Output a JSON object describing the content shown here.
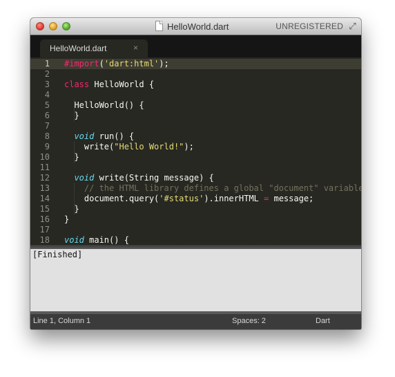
{
  "window": {
    "title": "HelloWorld.dart",
    "license_notice": "UNREGISTERED"
  },
  "tabs": [
    {
      "label": "HelloWorld.dart",
      "close_glyph": "×",
      "active": true
    }
  ],
  "editor": {
    "lines": [
      {
        "n": "1",
        "tokens": [
          {
            "t": "#import",
            "c": "kw"
          },
          {
            "t": "(",
            "c": ""
          },
          {
            "t": "'dart:html'",
            "c": "st"
          },
          {
            "t": ");",
            "c": ""
          }
        ]
      },
      {
        "n": "2",
        "tokens": []
      },
      {
        "n": "3",
        "tokens": [
          {
            "t": "class",
            "c": "kw"
          },
          {
            "t": " HelloWorld {",
            "c": ""
          }
        ]
      },
      {
        "n": "4",
        "tokens": []
      },
      {
        "n": "5",
        "tokens": [
          {
            "t": "  HelloWorld() {",
            "c": ""
          }
        ]
      },
      {
        "n": "6",
        "tokens": [
          {
            "t": "  }",
            "c": ""
          }
        ]
      },
      {
        "n": "7",
        "tokens": []
      },
      {
        "n": "8",
        "tokens": [
          {
            "t": "  ",
            "c": ""
          },
          {
            "t": "void",
            "c": "ty"
          },
          {
            "t": " run() {",
            "c": ""
          }
        ]
      },
      {
        "n": "9",
        "tokens": [
          {
            "t": "    write(",
            "c": ""
          },
          {
            "t": "\"Hello World!\"",
            "c": "st"
          },
          {
            "t": ");",
            "c": ""
          }
        ]
      },
      {
        "n": "10",
        "tokens": [
          {
            "t": "  }",
            "c": ""
          }
        ]
      },
      {
        "n": "11",
        "tokens": []
      },
      {
        "n": "12",
        "tokens": [
          {
            "t": "  ",
            "c": ""
          },
          {
            "t": "void",
            "c": "ty"
          },
          {
            "t": " write(String message) {",
            "c": ""
          }
        ]
      },
      {
        "n": "13",
        "tokens": [
          {
            "t": "    ",
            "c": ""
          },
          {
            "t": "// the HTML library defines a global \"document\" variable",
            "c": "cm"
          }
        ]
      },
      {
        "n": "14",
        "tokens": [
          {
            "t": "    document.query(",
            "c": ""
          },
          {
            "t": "'#status'",
            "c": "st"
          },
          {
            "t": ").innerHTML ",
            "c": ""
          },
          {
            "t": "=",
            "c": "kw"
          },
          {
            "t": " message;",
            "c": ""
          }
        ]
      },
      {
        "n": "15",
        "tokens": [
          {
            "t": "  }",
            "c": ""
          }
        ]
      },
      {
        "n": "16",
        "tokens": [
          {
            "t": "}",
            "c": ""
          }
        ]
      },
      {
        "n": "17",
        "tokens": []
      },
      {
        "n": "18",
        "tokens": [
          {
            "t": "void",
            "c": "ty"
          },
          {
            "t": " main() {",
            "c": ""
          }
        ]
      }
    ]
  },
  "output": {
    "text": "[Finished]"
  },
  "status": {
    "position": "Line 1, Column 1",
    "indentation": "Spaces: 2",
    "syntax": "Dart"
  },
  "colors": {
    "editor_background": "#272822",
    "keyword": "#f92672",
    "string": "#e6db74",
    "storage_type": "#66d9ef",
    "comment": "#75715e"
  },
  "icons": [
    "close-window-icon",
    "minimize-window-icon",
    "zoom-window-icon",
    "document-icon",
    "fullscreen-icon",
    "tab-close-icon"
  ]
}
